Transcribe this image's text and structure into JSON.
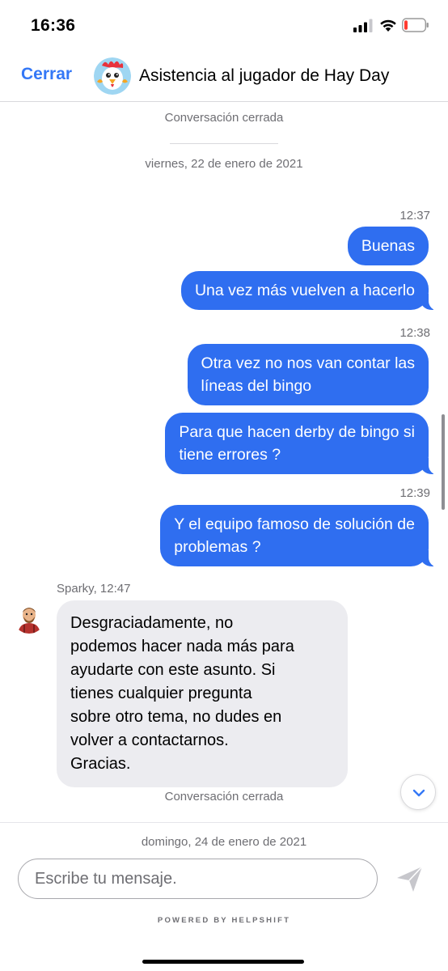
{
  "status_bar": {
    "time": "16:36",
    "icons": [
      "cellular-signal-icon",
      "wifi-icon",
      "battery-low-icon"
    ]
  },
  "header": {
    "close_label": "Cerrar",
    "title": "Asistencia al jugador de Hay Day",
    "avatar_icon": "rooster-avatar-icon"
  },
  "chat": {
    "closed_top": "Conversación cerrada",
    "date_1": "viernes, 22 de enero de 2021",
    "time_1": "12:37",
    "msg_1": "Buenas",
    "msg_2": "Una vez más vuelven a hacerlo",
    "time_2": "12:38",
    "msg_3_line1": "Otra vez no nos van contar las",
    "msg_3_line2": "líneas del bingo",
    "msg_4_line1": "Para que hacen derby de bingo si",
    "msg_4_line2": "tiene errores ?",
    "time_3": "12:39",
    "msg_5_line1": "Y el equipo famoso de solución de",
    "msg_5_line2": "problemas ?",
    "agent_meta": "Sparky, 12:47",
    "agent_avatar_icon": "farmer-avatar-icon",
    "agent_lines": [
      "Desgraciadamente, no",
      "podemos hacer nada más para",
      "ayudarte con este asunto. Si",
      "tienes cualquier pregunta",
      "sobre otro tema, no dudes en",
      "volver a contactarnos.",
      "Gracias."
    ],
    "closed_bottom": "Conversación cerrada",
    "date_2": "domingo, 24 de enero de 2021"
  },
  "composer": {
    "placeholder": "Escribe tu mensaje.",
    "send_icon": "send-paper-plane-icon",
    "powered_by": "POWERED BY HELPSHIFT"
  },
  "colors": {
    "accent": "#3478f6",
    "outgoing_bubble": "#2f6ef0",
    "incoming_bubble": "#ececf0",
    "meta_text": "#6e6e73"
  }
}
